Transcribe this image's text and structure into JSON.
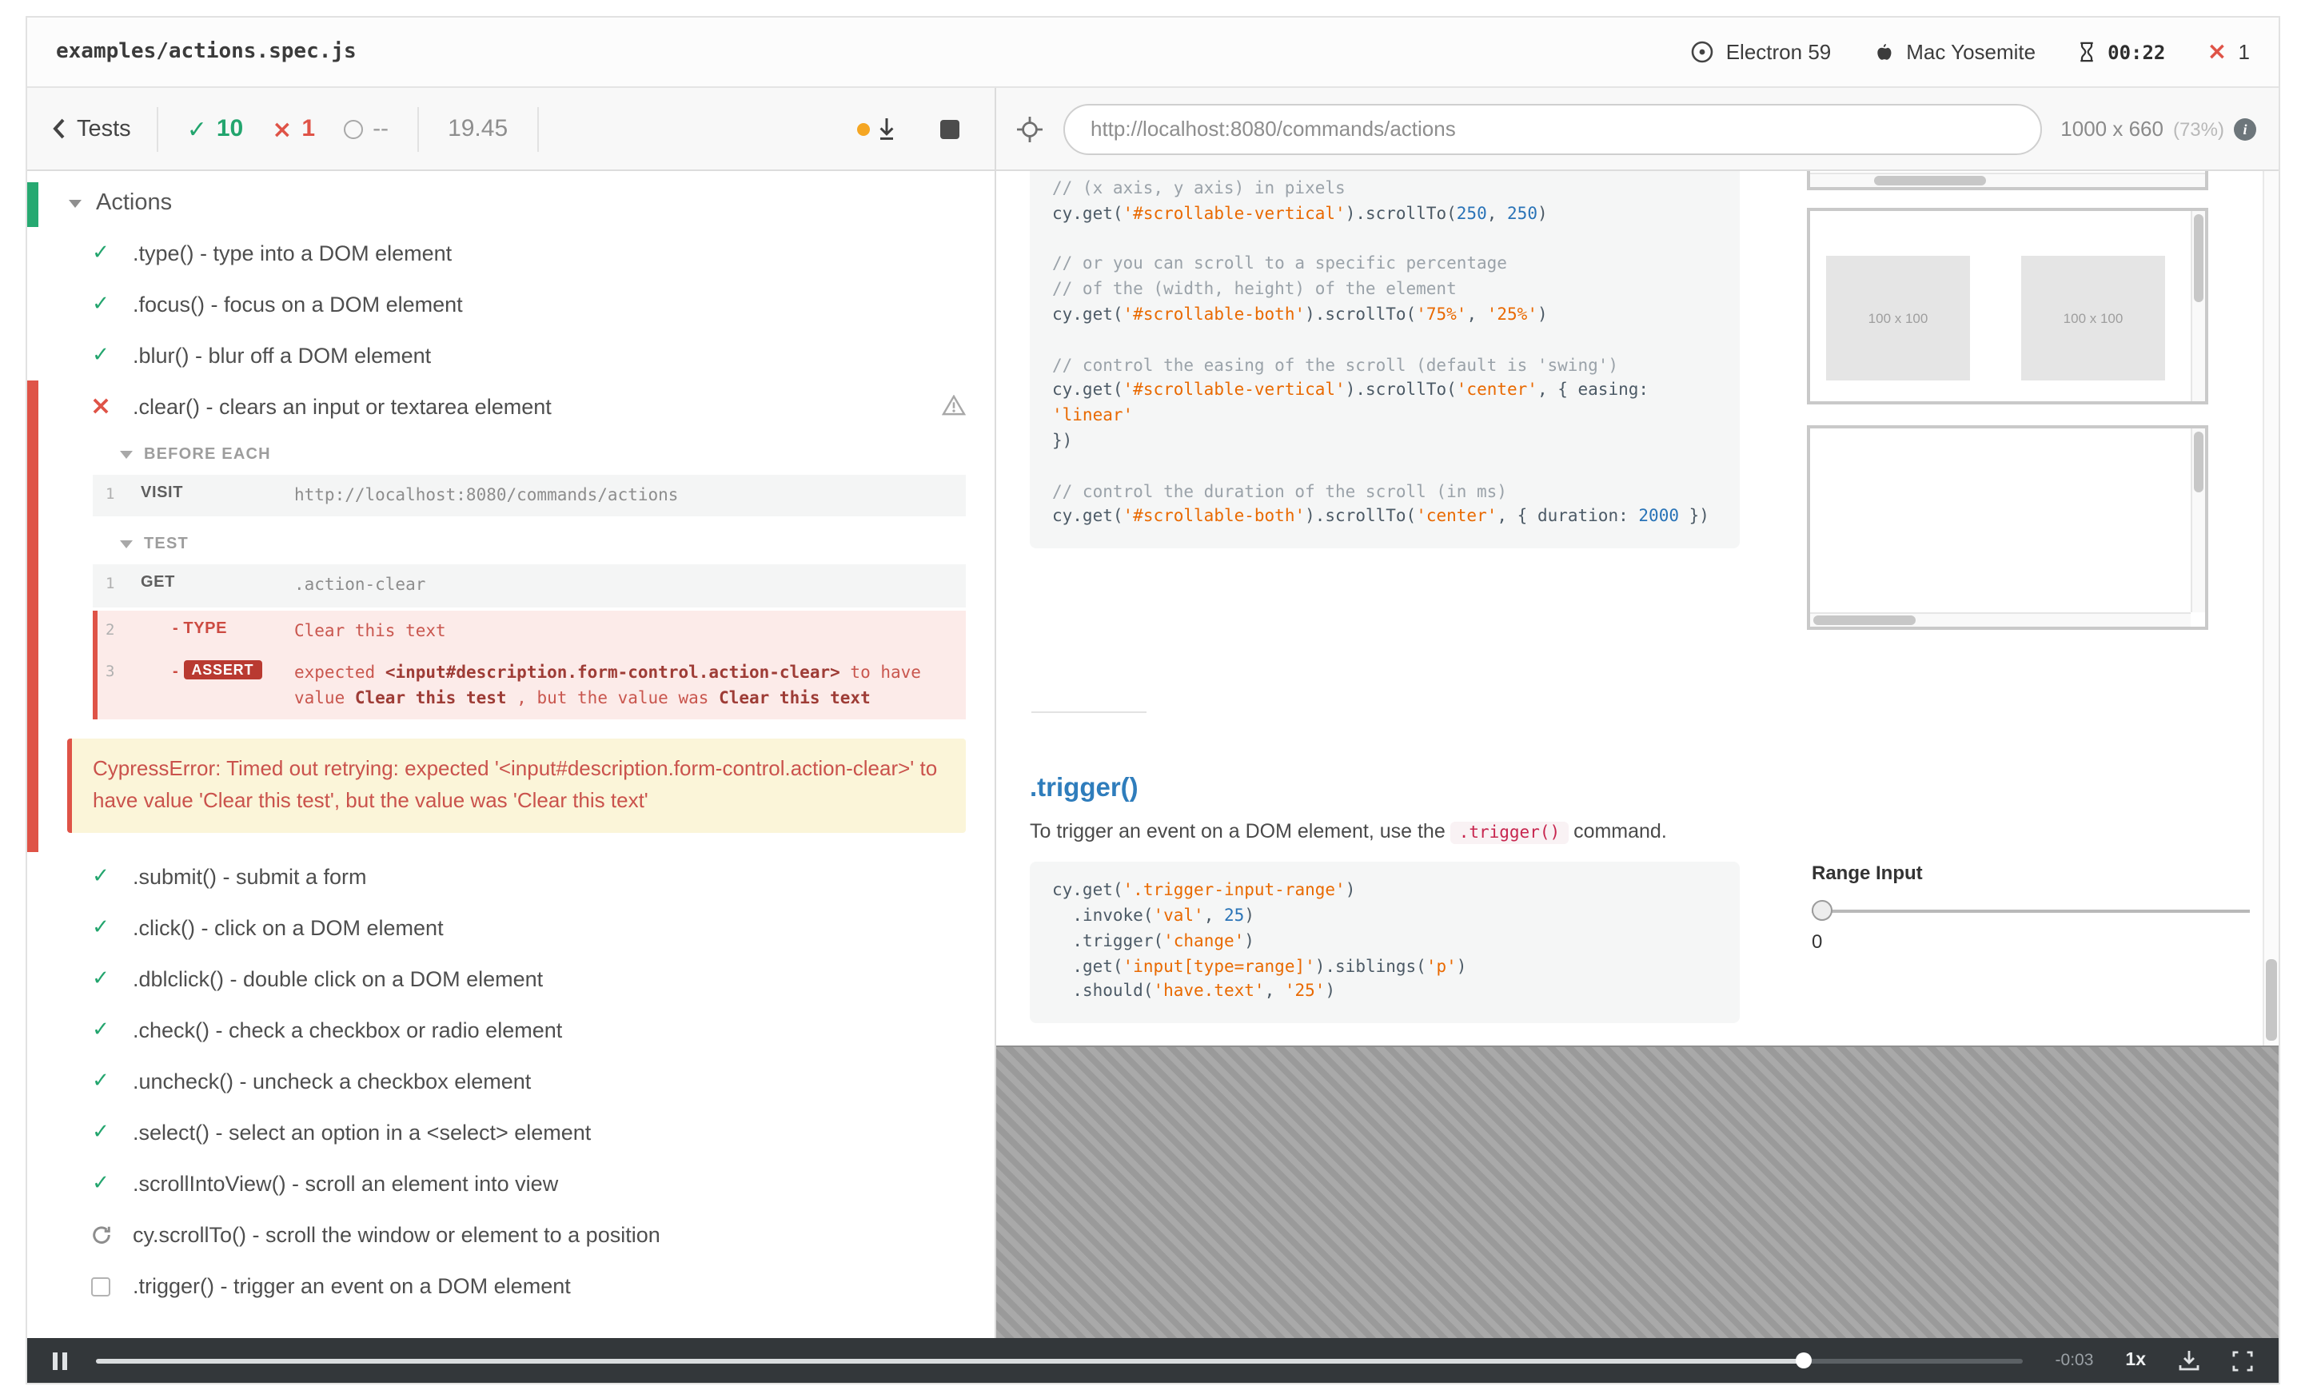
{
  "icons": {
    "check": "✓",
    "cross": "×",
    "info": "i"
  },
  "header": {
    "spec": "examples/actions.spec.js",
    "browser": "Electron 59",
    "os": "Mac Yosemite",
    "time": "00:22",
    "fail_count": "1"
  },
  "toolbar": {
    "back": "Tests",
    "passed": "10",
    "failed": "1",
    "pending": "--",
    "duration": "19.45",
    "url": "http://localhost:8080/commands/actions",
    "viewport": "1000 x 660",
    "zoom": "(73%)"
  },
  "reporter": {
    "suite": "Actions",
    "tests_before": [
      ".type() - type into a DOM element",
      ".focus() - focus on a DOM element",
      ".blur() - blur off a DOM element"
    ],
    "failed_test": {
      "title": ".clear() - clears an input or textarea element",
      "hooks": [
        {
          "label": "BEFORE EACH",
          "commands": [
            {
              "num": "1",
              "method": "VISIT",
              "child": false,
              "failed": false,
              "message": [
                [
                  "t",
                  "http://localhost:8080/commands/actions"
                ]
              ]
            }
          ]
        },
        {
          "label": "TEST",
          "commands": [
            {
              "num": "1",
              "method": "GET",
              "child": false,
              "failed": false,
              "message": [
                [
                  "t",
                  ".action-clear"
                ]
              ]
            },
            {
              "num": "2",
              "method": "- TYPE",
              "child": true,
              "failed": true,
              "message": [
                [
                  "t",
                  "Clear this text"
                ]
              ]
            },
            {
              "num": "3",
              "method": "- ",
              "badge": "ASSERT",
              "child": true,
              "failed": true,
              "message": [
                [
                  "t",
                  "expected "
                ],
                [
                  "b",
                  "<input#description.form-control.action-clear>"
                ],
                [
                  "t",
                  " to have value "
                ],
                [
                  "b",
                  "Clear this test"
                ],
                [
                  "t",
                  " , but the value was "
                ],
                [
                  "b",
                  "Clear this text"
                ]
              ]
            }
          ]
        }
      ],
      "error": "CypressError: Timed out retrying: expected '<input#description.form-control.action-clear>' to have value 'Clear this test', but the value was 'Clear this text'"
    },
    "tests_after": [
      {
        "icon": "check",
        "title": ".submit() - submit a form"
      },
      {
        "icon": "check",
        "title": ".click() - click on a DOM element"
      },
      {
        "icon": "check",
        "title": ".dblclick() - double click on a DOM element"
      },
      {
        "icon": "check",
        "title": ".check() - check a checkbox or radio element"
      },
      {
        "icon": "check",
        "title": ".uncheck() - uncheck a checkbox element"
      },
      {
        "icon": "check",
        "title": ".select() - select an option in a <select> element"
      },
      {
        "icon": "check",
        "title": ".scrollIntoView() - scroll an element into view"
      },
      {
        "icon": "refresh",
        "title": "cy.scrollTo() - scroll the window or element to a position"
      },
      {
        "icon": "box",
        "title": ".trigger() - trigger an event on a DOM element"
      }
    ]
  },
  "aut": {
    "placeholder": "100 x 100",
    "code1": [
      [
        [
          "c",
          "// (x axis, y axis) in pixels"
        ]
      ],
      [
        [
          "p",
          "cy.get("
        ],
        [
          "s",
          "'#scrollable-vertical'"
        ],
        [
          "p",
          ").scrollTo("
        ],
        [
          "n",
          "250"
        ],
        [
          "p",
          ", "
        ],
        [
          "n",
          "250"
        ],
        [
          "p",
          ")"
        ]
      ],
      [],
      [
        [
          "c",
          "// or you can scroll to a specific percentage"
        ]
      ],
      [
        [
          "c",
          "// of the (width, height) of the element"
        ]
      ],
      [
        [
          "p",
          "cy.get("
        ],
        [
          "s",
          "'#scrollable-both'"
        ],
        [
          "p",
          ").scrollTo("
        ],
        [
          "s",
          "'75%'"
        ],
        [
          "p",
          ", "
        ],
        [
          "s",
          "'25%'"
        ],
        [
          "p",
          ")"
        ]
      ],
      [],
      [
        [
          "c",
          "// control the easing of the scroll (default is 'swing')"
        ]
      ],
      [
        [
          "p",
          "cy.get("
        ],
        [
          "s",
          "'#scrollable-vertical'"
        ],
        [
          "p",
          ").scrollTo("
        ],
        [
          "s",
          "'center'"
        ],
        [
          "p",
          ", { easing: "
        ],
        [
          "s",
          "'linear'"
        ]
      ],
      [
        [
          "p",
          "})"
        ]
      ],
      [],
      [
        [
          "c",
          "// control the duration of the scroll (in ms)"
        ]
      ],
      [
        [
          "p",
          "cy.get("
        ],
        [
          "s",
          "'#scrollable-both'"
        ],
        [
          "p",
          ").scrollTo("
        ],
        [
          "s",
          "'center'"
        ],
        [
          "p",
          ", { duration: "
        ],
        [
          "n",
          "2000"
        ],
        [
          "p",
          " })"
        ]
      ]
    ],
    "section": {
      "heading": ".trigger()",
      "intro_before": "To trigger an event on a DOM element, use the ",
      "inline_code": ".trigger()",
      "intro_after": " command."
    },
    "code2": [
      [
        [
          "p",
          "cy.get("
        ],
        [
          "s",
          "'.trigger-input-range'"
        ],
        [
          "p",
          ")"
        ]
      ],
      [
        [
          "p",
          "  .invoke("
        ],
        [
          "s",
          "'val'"
        ],
        [
          "p",
          ", "
        ],
        [
          "n",
          "25"
        ],
        [
          "p",
          ")"
        ]
      ],
      [
        [
          "p",
          "  .trigger("
        ],
        [
          "s",
          "'change'"
        ],
        [
          "p",
          ")"
        ]
      ],
      [
        [
          "p",
          "  .get("
        ],
        [
          "s",
          "'input[type=range]'"
        ],
        [
          "p",
          ").siblings("
        ],
        [
          "s",
          "'p'"
        ],
        [
          "p",
          ")"
        ]
      ],
      [
        [
          "p",
          "  .should("
        ],
        [
          "s",
          "'have.text'"
        ],
        [
          "p",
          ", "
        ],
        [
          "s",
          "'25'"
        ],
        [
          "p",
          ")"
        ]
      ]
    ],
    "range": {
      "label": "Range Input",
      "value": "0"
    }
  },
  "player": {
    "time": "-0:03",
    "speed": "1x",
    "progress": 0.886
  }
}
